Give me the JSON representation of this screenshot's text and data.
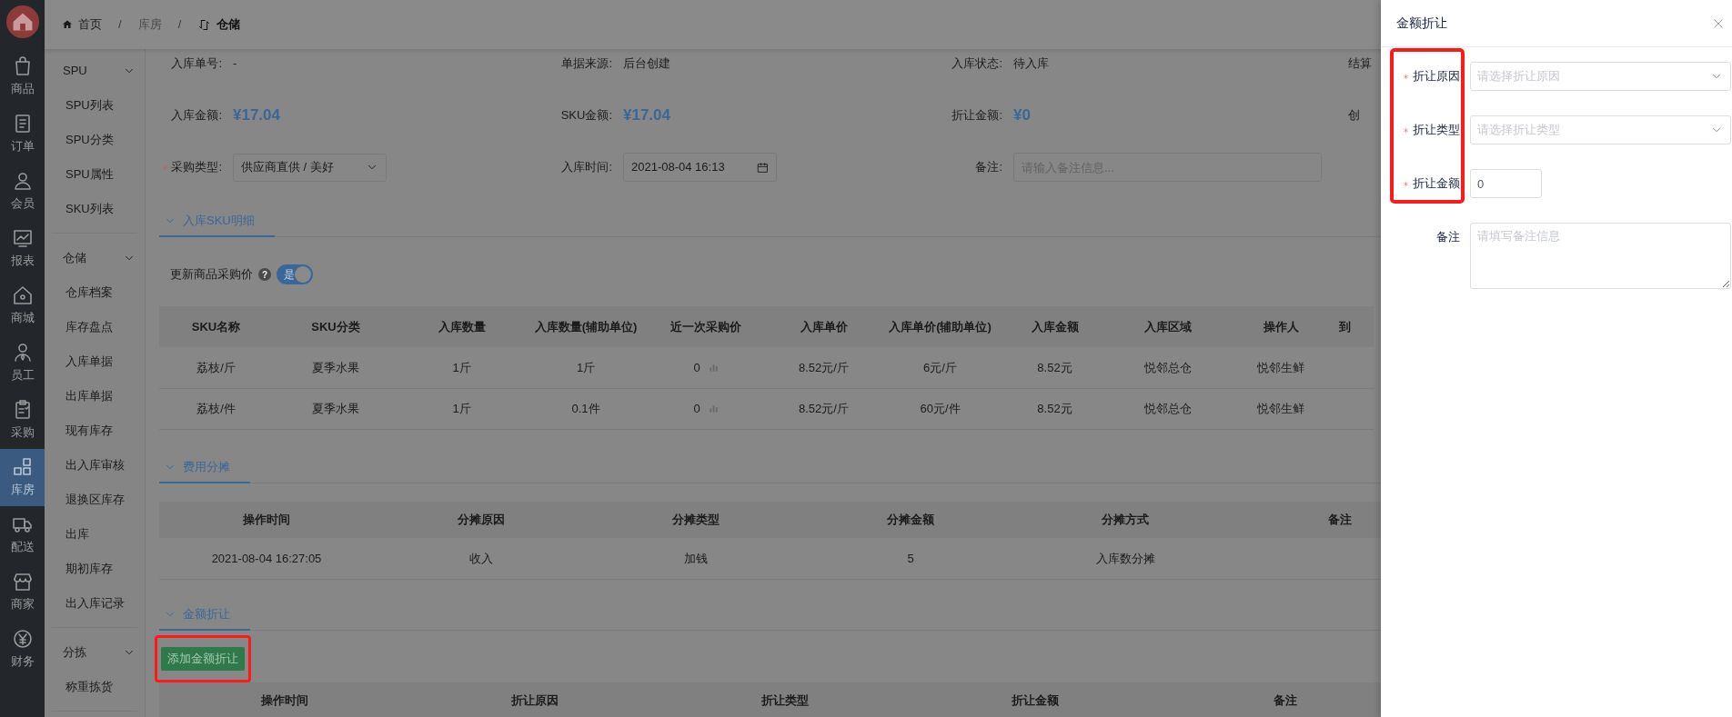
{
  "sidebar": {
    "items": [
      {
        "label": "商品",
        "selected": false
      },
      {
        "label": "订单",
        "selected": false
      },
      {
        "label": "会员",
        "selected": false
      },
      {
        "label": "报表",
        "selected": false
      },
      {
        "label": "商城",
        "selected": false
      },
      {
        "label": "员工",
        "selected": false
      },
      {
        "label": "采购",
        "selected": false
      },
      {
        "label": "库房",
        "selected": true
      },
      {
        "label": "配送",
        "selected": false
      },
      {
        "label": "商家",
        "selected": false
      },
      {
        "label": "财务",
        "selected": false
      }
    ]
  },
  "submenu": {
    "groups": [
      {
        "title": "SPU",
        "expanded": true,
        "items": [
          "SPU列表",
          "SPU分类",
          "SPU属性",
          "SKU列表"
        ]
      },
      {
        "title": "仓储",
        "expanded": true,
        "items": [
          "仓库档案",
          "库存盘点",
          "入库单据",
          "出库单据",
          "现有库存",
          "出入库审核",
          "退换区库存",
          "出库",
          "期初库存",
          "出入库记录"
        ]
      },
      {
        "title": "分拣",
        "expanded": true,
        "items": [
          "称重拣货"
        ]
      }
    ]
  },
  "breadcrumb": {
    "separator": "/",
    "items": [
      {
        "label": "首页",
        "current": false
      },
      {
        "label": "库房",
        "current": false
      },
      {
        "label": "仓储",
        "current": true
      }
    ]
  },
  "info": {
    "rows": [
      [
        {
          "label": "入库单号:",
          "kind": "text",
          "value": "-"
        },
        {
          "label": "单据来源:",
          "kind": "text",
          "value": "后台创建"
        },
        {
          "label": "入库状态:",
          "kind": "text",
          "value": "待入库"
        },
        {
          "label": "结算",
          "kind": "text"
        }
      ],
      [
        {
          "label": "入库金额:",
          "kind": "amount",
          "value": "¥17.04"
        },
        {
          "label": "SKU金额:",
          "kind": "amount",
          "value": "¥17.04"
        },
        {
          "label": "折让金额:",
          "kind": "amount",
          "value": "¥0"
        },
        {
          "label": "创",
          "kind": "text"
        }
      ],
      [
        {
          "label": "采购类型:",
          "kind": "select",
          "required": true,
          "value": "供应商直供 / 美好"
        },
        {
          "label": "入库时间:",
          "kind": "date",
          "required": false,
          "value": "2021-08-04 16:13"
        },
        {
          "label": "备注:",
          "kind": "input",
          "required": false,
          "placeholder": "请输入备注信息..."
        }
      ]
    ]
  },
  "sections": [
    {
      "title": "入库SKU明细",
      "expanded": true,
      "switch": {
        "label": "更新商品采购价",
        "help": "?",
        "on": true,
        "on_text": "是"
      },
      "table": {
        "columns": [
          {
            "label": "SKU名称",
            "kind": "text"
          },
          {
            "label": "SKU分类",
            "kind": "text"
          },
          {
            "label": "入库数量",
            "kind": "text"
          },
          {
            "label": "入库数量(辅助单位)",
            "kind": "text"
          },
          {
            "label": "近一次采购价",
            "kind": "price_trend"
          },
          {
            "label": "入库单价",
            "kind": "text"
          },
          {
            "label": "入库单价(辅助单位)",
            "kind": "text"
          },
          {
            "label": "入库金额",
            "kind": "text"
          },
          {
            "label": "入库区域",
            "kind": "text"
          },
          {
            "label": "操作人",
            "kind": "text"
          },
          {
            "label": "到",
            "kind": "text"
          }
        ],
        "rows": [
          [
            "荔枝/斤",
            "夏季水果",
            "1斤",
            "1斤",
            "0",
            "8.52元/斤",
            "6元/斤",
            "8.52元",
            "悦邻总仓",
            "悦邻生鲜"
          ],
          [
            "荔枝/件",
            "夏季水果",
            "1斤",
            "0.1件",
            "0",
            "8.52元/斤",
            "60元/件",
            "8.52元",
            "悦邻总仓",
            "悦邻生鲜"
          ]
        ]
      }
    },
    {
      "title": "费用分摊",
      "expanded": true,
      "table": {
        "columns": [
          {
            "label": "操作时间",
            "kind": "text"
          },
          {
            "label": "分摊原因",
            "kind": "text"
          },
          {
            "label": "分摊类型",
            "kind": "text"
          },
          {
            "label": "分摊金额",
            "kind": "text"
          },
          {
            "label": "分摊方式",
            "kind": "text"
          },
          {
            "label": "备注",
            "kind": "text"
          }
        ],
        "rows": [
          [
            "2021-08-04 16:27:05",
            "收入",
            "加钱",
            "5",
            "入库数分摊"
          ]
        ]
      }
    },
    {
      "title": "金额折让",
      "expanded": true,
      "button": {
        "label": "添加金额折让",
        "highlighted": true
      },
      "table": {
        "columns": [
          {
            "label": "操作时间",
            "kind": "text"
          },
          {
            "label": "折让原因",
            "kind": "text"
          },
          {
            "label": "折让类型",
            "kind": "text"
          },
          {
            "label": "折让金额",
            "kind": "text"
          },
          {
            "label": "备注",
            "kind": "text"
          }
        ]
      }
    }
  ],
  "drawer": {
    "title": "金额折让",
    "highlight_required_labels": true,
    "fields": [
      {
        "label": "折让原因",
        "required": true,
        "kind": "select",
        "placeholder": "请选择折让原因"
      },
      {
        "label": "折让类型",
        "required": true,
        "kind": "select",
        "placeholder": "请选择折让类型"
      },
      {
        "label": "折让金额",
        "required": true,
        "kind": "number",
        "value": "0"
      },
      {
        "label": "备注",
        "required": false,
        "kind": "textarea",
        "placeholder": "请填写备注信息"
      }
    ]
  }
}
